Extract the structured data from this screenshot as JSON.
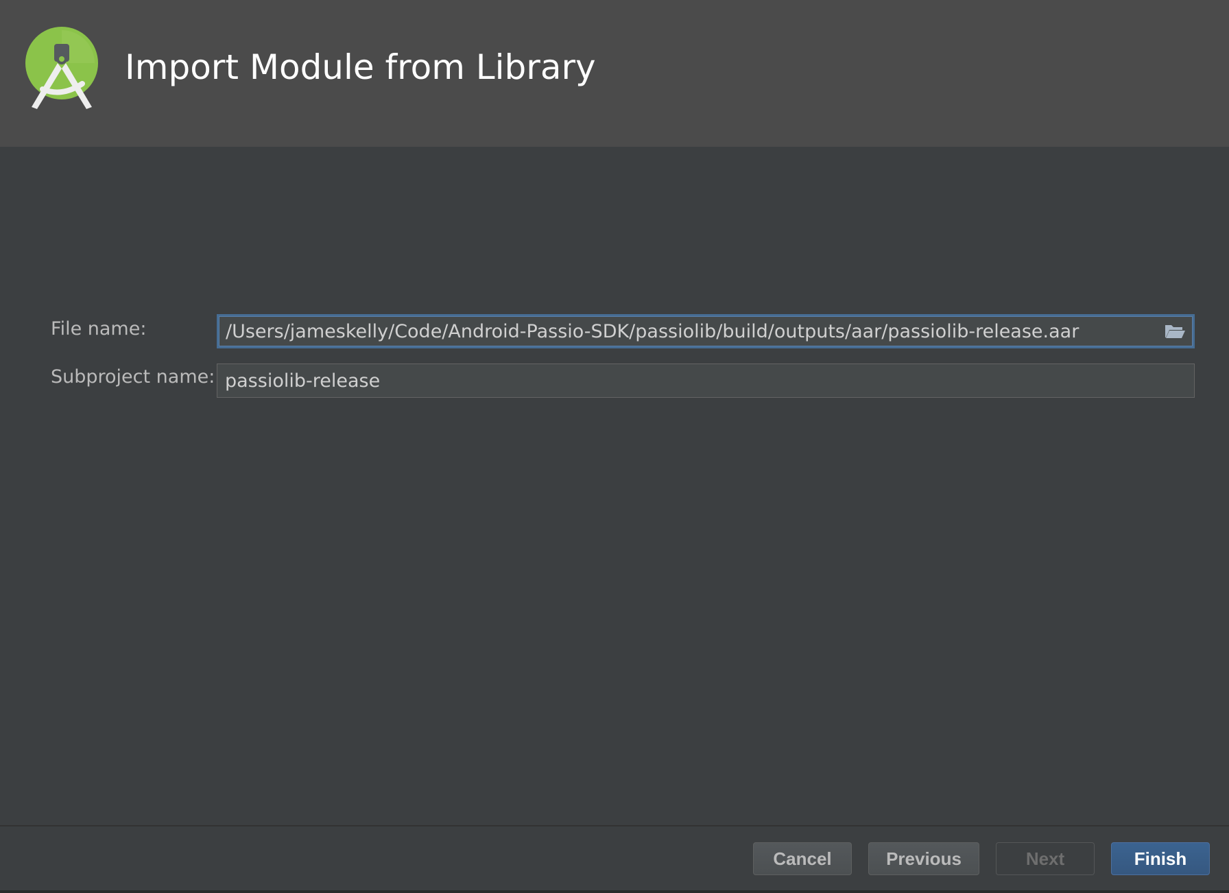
{
  "header": {
    "title": "Import Module from Library",
    "logo_icon": "android-studio-logo-icon"
  },
  "form": {
    "file_name": {
      "label": "File name:",
      "value": "/Users/jameskelly/Code/Android-Passio-SDK/passiolib/build/outputs/aar/passiolib-release.aar",
      "browse_icon": "folder-open-icon"
    },
    "subproject_name": {
      "label": "Subproject name:",
      "value": "passiolib-release"
    }
  },
  "footer": {
    "cancel_label": "Cancel",
    "previous_label": "Previous",
    "next_label": "Next",
    "finish_label": "Finish"
  },
  "colors": {
    "background": "#3c3f41",
    "header_background": "#4b4b4b",
    "focus_border": "#466d94",
    "primary_button": "#365880",
    "logo_green": "#8bc34a"
  }
}
